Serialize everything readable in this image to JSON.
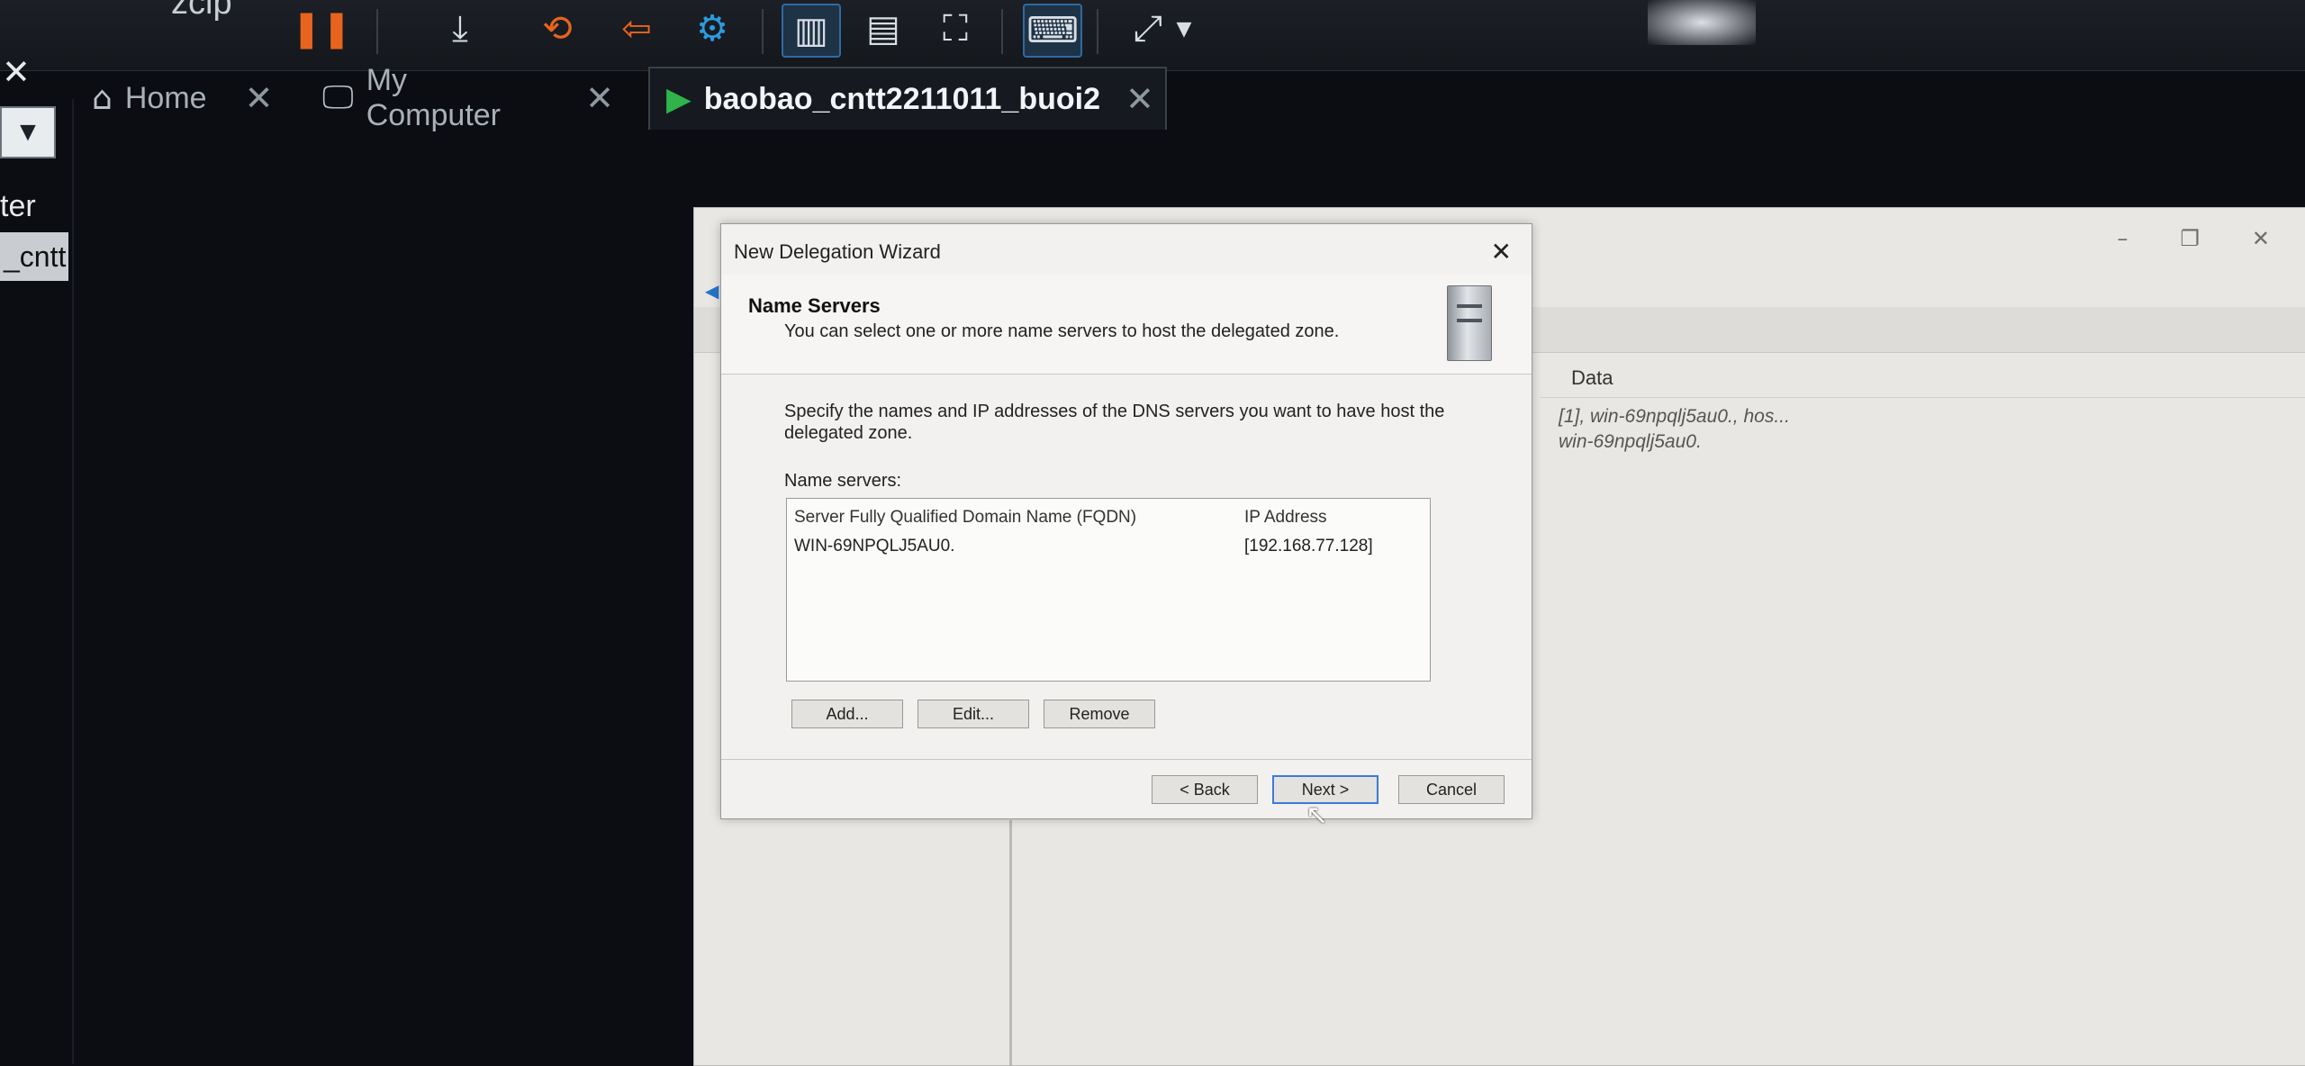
{
  "host": {
    "toolbar_partial_text": "zcip",
    "left_pane": {
      "close_glyph": "✕",
      "dropdown_glyph": "▼",
      "label_partial": "ter",
      "selected_item_partial": "_cntt"
    },
    "tabs": [
      {
        "label": "Home",
        "icon": "home-icon",
        "close": "✕"
      },
      {
        "label": "My Computer",
        "icon": "monitor-icon",
        "close": "✕"
      },
      {
        "label": "baobao_cntt2211011_buoi2",
        "icon": "vm-play-icon",
        "close": "✕"
      }
    ]
  },
  "dns_console": {
    "column_header_data": "Data",
    "data_rows": [
      "[1], win-69npqlj5au0., hos...",
      "win-69npqlj5au0."
    ],
    "window_controls": [
      "–",
      "❐",
      "✕"
    ]
  },
  "wizard": {
    "title": "New Delegation Wizard",
    "close_glyph": "✕",
    "section_title": "Name Servers",
    "section_subtitle": "You can select one or more name servers to host the delegated zone.",
    "description": "Specify the names and IP addresses of the DNS servers you want to have host the delegated zone.",
    "name_servers_label": "Name servers:",
    "table": {
      "columns": [
        "Server Fully Qualified Domain Name (FQDN)",
        "IP Address"
      ],
      "rows": [
        {
          "fqdn": "WIN-69NPQLJ5AU0.",
          "ip": "[192.168.77.128]"
        }
      ]
    },
    "buttons": {
      "add": "Add...",
      "edit": "Edit...",
      "remove": "Remove",
      "back": "< Back",
      "next": "Next >",
      "cancel": "Cancel"
    }
  }
}
